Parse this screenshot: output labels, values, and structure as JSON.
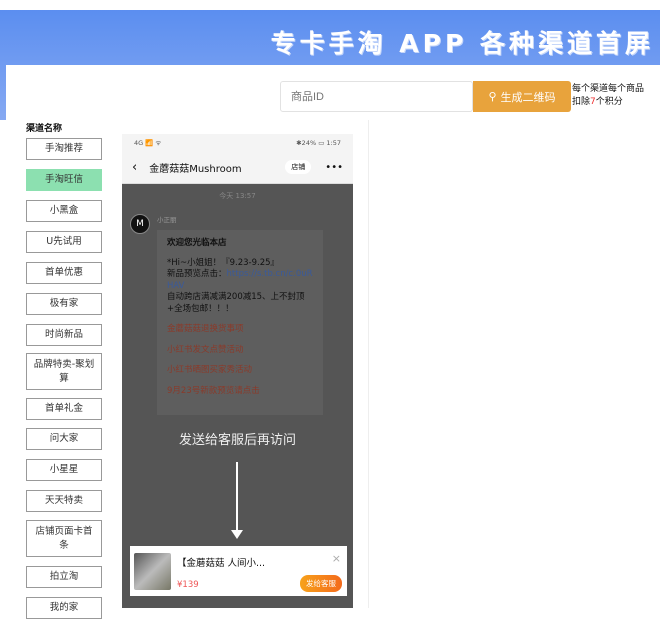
{
  "banner": {
    "title": "专卡手淘 APP 各种渠道首屏"
  },
  "search": {
    "placeholder": "商品ID",
    "button": "生成二维码",
    "note_pre": "每个渠道每个商品扣除",
    "note_num": "7",
    "note_post": "个积分"
  },
  "channels": {
    "title": "渠道名称",
    "items": [
      "手淘推荐",
      "手淘旺信",
      "小黑盒",
      "U先试用",
      "首单优惠",
      "极有家",
      "时尚新品",
      "品牌特卖-聚划算",
      "首单礼金",
      "问大家",
      "小星星",
      "天天特卖",
      "店铺页面卡首条",
      "拍立淘",
      "我的家"
    ],
    "active": "手淘旺信"
  },
  "phone": {
    "status_left": "4G 📶 ᯤ",
    "status_right": "✱24% ▭ 1:57",
    "shop_name": "金蘑菇菇Mushroom",
    "shop_btn": "店铺",
    "more": "•••",
    "time": "今天 13:57",
    "sender": "小正丽",
    "avatar": "M",
    "msg_title": "欢迎您光临本店",
    "msg_line1": "*Hi~小姐姐！『9.23-9.25』",
    "msg_line2": "新品预览点击：",
    "msg_link": "https://s.tb.cn/c.0uRHAV",
    "msg_line3": "自动跨店满减满200减15、上不封顶+全场包邮！！！",
    "links": [
      "金蘑菇菇退换货事项",
      "小红书发文点赞活动",
      "小红书晒图买家秀活动",
      "9月23号新款预览请点击"
    ],
    "send_tip": "发送给客服后再访问",
    "card": {
      "title": "【金蘑菇菇 人间小...",
      "price": "¥139",
      "send": "发给客服",
      "close": "×"
    }
  }
}
